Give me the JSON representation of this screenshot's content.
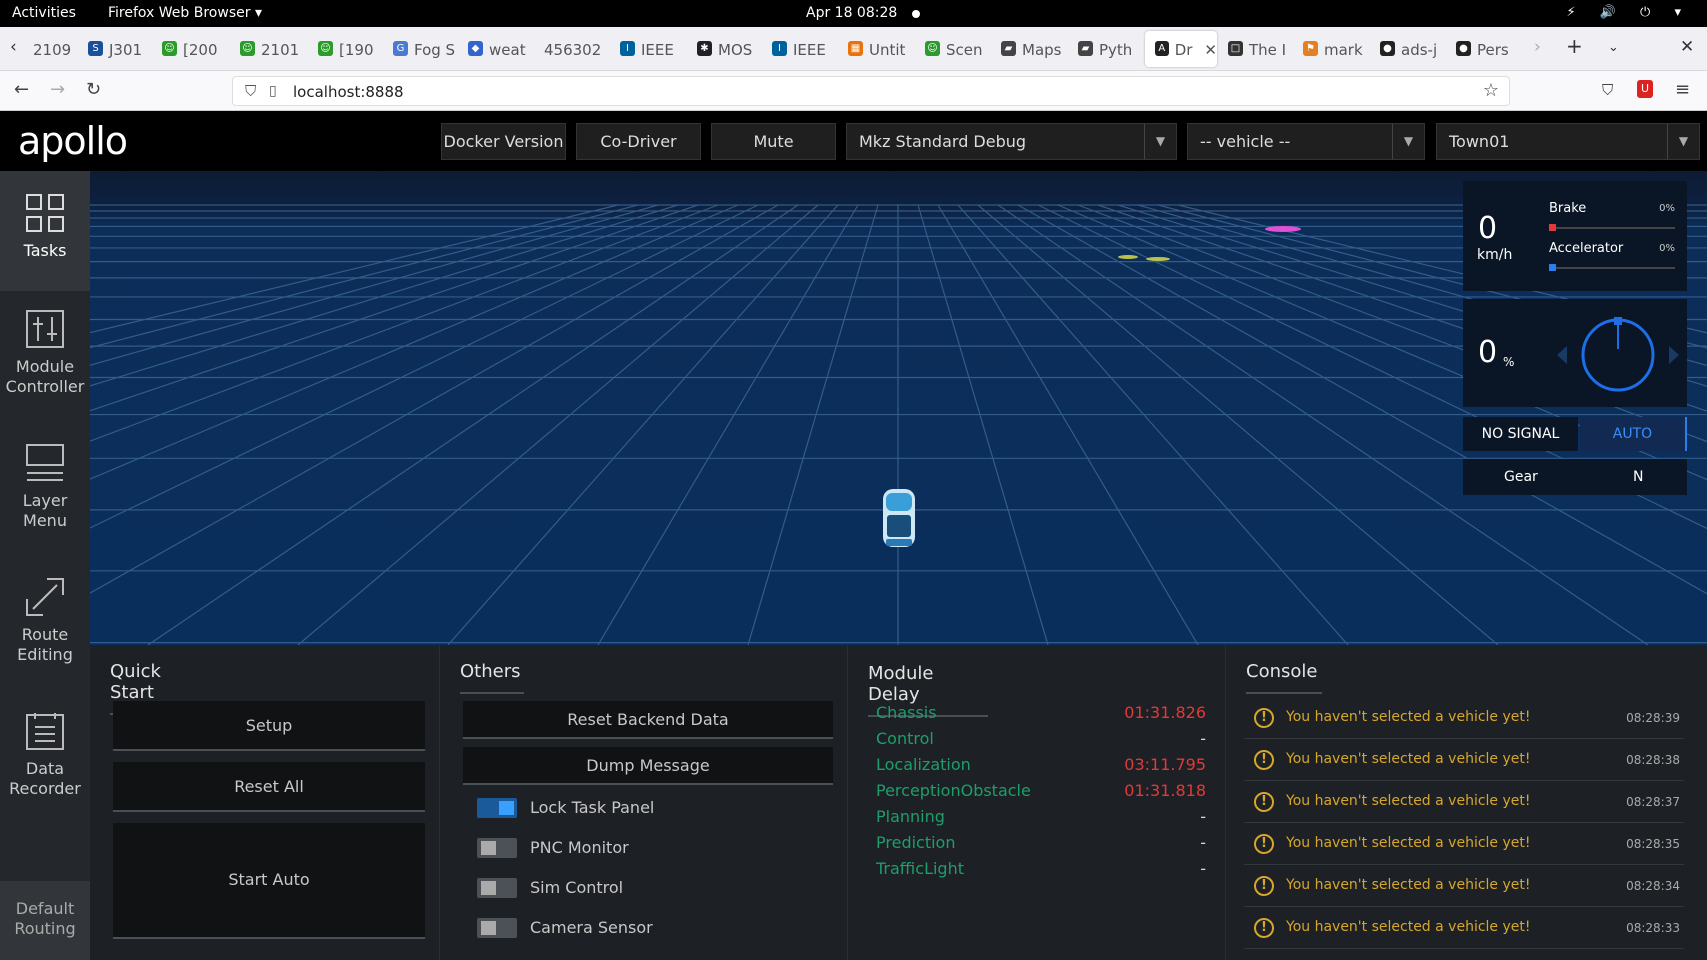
{
  "os_bar": {
    "activities": "Activities",
    "app": "Firefox Web Browser ▾",
    "clock": "Apr 18  08:28",
    "tray": "⚡ 🔊 ⏻ ▾"
  },
  "tabs": [
    {
      "label": "2109",
      "fav": "",
      "col": "#888"
    },
    {
      "label": "J301",
      "fav": "S",
      "col": "#1a4f9c"
    },
    {
      "label": "[200",
      "fav": "☺",
      "col": "#2c9a2c"
    },
    {
      "label": "2101",
      "fav": "☺",
      "col": "#2c9a2c"
    },
    {
      "label": "[190",
      "fav": "☺",
      "col": "#2c9a2c"
    },
    {
      "label": "Fog S",
      "fav": "G",
      "col": "#4a7bd0"
    },
    {
      "label": "weat",
      "fav": "◆",
      "col": "#3366cc"
    },
    {
      "label": "456302",
      "fav": "",
      "col": "#888"
    },
    {
      "label": "IEEE",
      "fav": "I",
      "col": "#00629b"
    },
    {
      "label": "MOS",
      "fav": "✱",
      "col": "#222"
    },
    {
      "label": "IEEE",
      "fav": "I",
      "col": "#00629b"
    },
    {
      "label": "Untit",
      "fav": "▦",
      "col": "#e8730c"
    },
    {
      "label": "Scen",
      "fav": "☺",
      "col": "#2c9a2c"
    },
    {
      "label": "Maps",
      "fav": "▰",
      "col": "#444"
    },
    {
      "label": "Pyth",
      "fav": "▰",
      "col": "#444"
    },
    {
      "label": "Dr",
      "fav": "A",
      "col": "#222"
    },
    {
      "label": "The I",
      "fav": "□",
      "col": "#333"
    },
    {
      "label": "mark",
      "fav": "⚑",
      "col": "#e67e22"
    },
    {
      "label": "ads-j",
      "fav": "●",
      "col": "#222"
    },
    {
      "label": "Pers",
      "fav": "●",
      "col": "#222"
    }
  ],
  "url": "localhost:8888",
  "header": {
    "logo": "apollo",
    "docker": "Docker Version",
    "codriver": "Co-Driver",
    "mute": "Mute",
    "mode": "Mkz Standard Debug",
    "vehicle": "-- vehicle --",
    "map": "Town01"
  },
  "sidebar": [
    {
      "label": "Tasks",
      "active": true
    },
    {
      "label": "Module Controller",
      "active": false
    },
    {
      "label": "Layer Menu",
      "active": false
    },
    {
      "label": "Route Editing",
      "active": false
    },
    {
      "label": "Data Recorder",
      "active": false
    }
  ],
  "sidebar_default": "Default Routing",
  "dashboard": {
    "speed": "0",
    "speed_unit": "km/h",
    "brake_label": "Brake",
    "brake_val": "0%",
    "accel_label": "Accelerator",
    "accel_val": "0%",
    "steer": "0",
    "steer_unit": "%",
    "signal": "NO SIGNAL",
    "drive_mode": "AUTO",
    "gear_label": "Gear",
    "gear": "N"
  },
  "quick_start": {
    "title": "Quick Start",
    "setup": "Setup",
    "reset": "Reset All",
    "start": "Start Auto"
  },
  "others": {
    "title": "Others",
    "reset_backend": "Reset Backend Data",
    "dump": "Dump Message",
    "toggles": [
      {
        "label": "Lock Task Panel",
        "on": true
      },
      {
        "label": "PNC Monitor",
        "on": false
      },
      {
        "label": "Sim Control",
        "on": false
      },
      {
        "label": "Camera Sensor",
        "on": false
      }
    ]
  },
  "module_delay": {
    "title": "Module Delay",
    "rows": [
      {
        "name": "Chassis",
        "value": "01:31.826",
        "red": true
      },
      {
        "name": "Control",
        "value": "-",
        "red": false
      },
      {
        "name": "Localization",
        "value": "03:11.795",
        "red": true
      },
      {
        "name": "PerceptionObstacle",
        "value": "01:31.818",
        "red": true
      },
      {
        "name": "Planning",
        "value": "-",
        "red": false
      },
      {
        "name": "Prediction",
        "value": "-",
        "red": false
      },
      {
        "name": "TrafficLight",
        "value": "-",
        "red": false
      }
    ]
  },
  "console": {
    "title": "Console",
    "rows": [
      {
        "msg": "You haven't selected a vehicle yet!",
        "time": "08:28:39"
      },
      {
        "msg": "You haven't selected a vehicle yet!",
        "time": "08:28:38"
      },
      {
        "msg": "You haven't selected a vehicle yet!",
        "time": "08:28:37"
      },
      {
        "msg": "You haven't selected a vehicle yet!",
        "time": "08:28:35"
      },
      {
        "msg": "You haven't selected a vehicle yet!",
        "time": "08:28:34"
      },
      {
        "msg": "You haven't selected a vehicle yet!",
        "time": "08:28:33"
      }
    ]
  }
}
